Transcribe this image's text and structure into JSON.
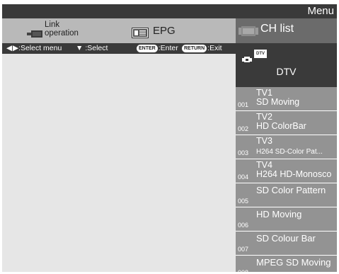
{
  "window": {
    "title": "Menu"
  },
  "menu": {
    "link_operation_label": "Link\noperation",
    "epg_label": "EPG",
    "ch_list_label": "CH list"
  },
  "help": {
    "select_menu": ":Select menu",
    "select": ":Select",
    "enter_key": "ENTER",
    "enter": ":Enter",
    "return_key": "RETURN",
    "exit": ":Exit"
  },
  "source": {
    "badge": "DTV",
    "name": "DTV"
  },
  "channels": [
    {
      "number": "001",
      "name": "TV1",
      "program": "SD Moving"
    },
    {
      "number": "002",
      "name": "TV2",
      "program": "HD ColorBar"
    },
    {
      "number": "003",
      "name": "TV3",
      "program": "H264 SD-Color Pat..."
    },
    {
      "number": "004",
      "name": "TV4",
      "program": "H264 HD-Monosco"
    },
    {
      "number": "005",
      "name": "SD Color Pattern"
    },
    {
      "number": "006",
      "name": "HD Moving"
    },
    {
      "number": "007",
      "name": "SD Colour Bar"
    },
    {
      "number": "008",
      "name": "MPEG SD Moving"
    }
  ],
  "colors": {
    "title_bar": "#3a3a3a",
    "menu_bar": "#b9b9b9",
    "selected_tab": "#6b6b6b",
    "channel_item": "#939393",
    "content_area": "#e6e6e6"
  }
}
